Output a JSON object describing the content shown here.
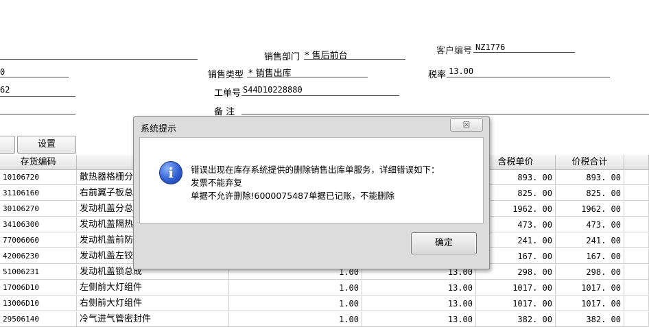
{
  "form": {
    "dept_label": "销售部门",
    "dept_value": "* 售后前台",
    "cust_label": "客户编号",
    "cust_value": "NZ1776",
    "type_label": "销售类型",
    "type_value": "* 销售出库",
    "tax_label": "税率",
    "tax_value": "13.00",
    "order_label": "工单号",
    "order_value": "S44D10228880",
    "note_label": "备  注",
    "left_value_1": "0",
    "left_value_2": "62"
  },
  "toolbar": {
    "settings_label": "设置"
  },
  "table": {
    "headers": {
      "code": "存货编码",
      "price": "含税单价",
      "total": "价税合计"
    },
    "rows": [
      {
        "code": "10106720",
        "name": "散热器格栅分",
        "qty": "",
        "tax": "",
        "price": "893. 00",
        "total": "893. 00"
      },
      {
        "code": "31106160",
        "name": "右前翼子板总",
        "qty": "",
        "tax": "",
        "price": "825. 00",
        "total": "825. 00"
      },
      {
        "code": "30106270",
        "name": "发动机盖分总",
        "qty": "",
        "tax": "",
        "price": "1962. 00",
        "total": "1962. 00"
      },
      {
        "code": "34106300",
        "name": "发动机盖隔热",
        "qty": "",
        "tax": "",
        "price": "473. 00",
        "total": "473. 00"
      },
      {
        "code": "77006060",
        "name": "发动机盖前防",
        "qty": "",
        "tax": "",
        "price": "241. 00",
        "total": "241. 00"
      },
      {
        "code": "42006230",
        "name": "发动机盖左铰",
        "qty": "",
        "tax": "",
        "price": "167. 00",
        "total": "167. 00"
      },
      {
        "code": "51006231",
        "name": "发动机盖锁总成",
        "qty": "1.00",
        "tax": "13.00",
        "price": "298. 00",
        "total": "298. 00"
      },
      {
        "code": "17006D10",
        "name": "左侧前大灯组件",
        "qty": "1.00",
        "tax": "13.00",
        "price": "1017. 00",
        "total": "1017. 00"
      },
      {
        "code": "13006D10",
        "name": "右侧前大灯组件",
        "qty": "1.00",
        "tax": "13.00",
        "price": "1017. 00",
        "total": "1017. 00"
      },
      {
        "code": "29506140",
        "name": "冷气进气管密封件",
        "qty": "1.00",
        "tax": "13.00",
        "price": "382. 00",
        "total": "382. 00"
      }
    ]
  },
  "dialog": {
    "title": "系统提示",
    "close_label": "☒",
    "line1": "错误出现在库存系统提供的删除销售出库单服务，详细错误如下：",
    "line2": "发票不能弃复",
    "line3": "单据不允许删除!6000075487单据已记账，不能删除",
    "ok_label": "确定"
  },
  "colors": {
    "dialog_bg": "#dcdcdc",
    "icon_blue": "#2f5fd0"
  }
}
